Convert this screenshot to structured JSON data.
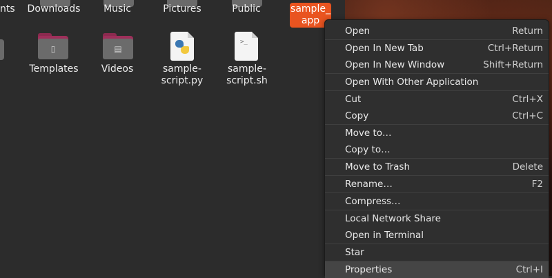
{
  "files": {
    "top_row": [
      {
        "name": "nts"
      },
      {
        "name": "Downloads"
      },
      {
        "name": "Music"
      },
      {
        "name": "Pictures"
      },
      {
        "name": "Public"
      }
    ],
    "selected_item": {
      "line1": "sample_",
      "line2": "app"
    },
    "second_row": [
      {
        "name": "Templates",
        "icon": "folder-templates-icon"
      },
      {
        "name": "Videos",
        "icon": "folder-videos-icon"
      },
      {
        "name_line1": "sample-",
        "name_line2": "script.py",
        "icon": "python-file-icon"
      },
      {
        "name_line1": "sample-",
        "name_line2": "script.sh",
        "icon": "shell-script-icon"
      }
    ]
  },
  "context_menu": {
    "items": [
      {
        "label": "Open",
        "accel": "Return"
      },
      {
        "label": "Open In New Tab",
        "accel": "Ctrl+Return"
      },
      {
        "label": "Open In New Window",
        "accel": "Shift+Return"
      },
      {
        "label": "Open With Other Application",
        "accel": ""
      },
      {
        "label": "Cut",
        "accel": "Ctrl+X"
      },
      {
        "label": "Copy",
        "accel": "Ctrl+C"
      },
      {
        "label": "Move to…",
        "accel": ""
      },
      {
        "label": "Copy to…",
        "accel": ""
      },
      {
        "label": "Move to Trash",
        "accel": "Delete"
      },
      {
        "label": "Rename…",
        "accel": "F2"
      },
      {
        "label": "Compress…",
        "accel": ""
      },
      {
        "label": "Local Network Share",
        "accel": ""
      },
      {
        "label": "Open in Terminal",
        "accel": ""
      },
      {
        "label": "Star",
        "accel": ""
      },
      {
        "label": "Properties",
        "accel": "Ctrl+I"
      }
    ]
  },
  "colors": {
    "accent": "#e95420",
    "menu_bg": "#2f2f2f",
    "folder_accent": "#9e2f5a"
  }
}
